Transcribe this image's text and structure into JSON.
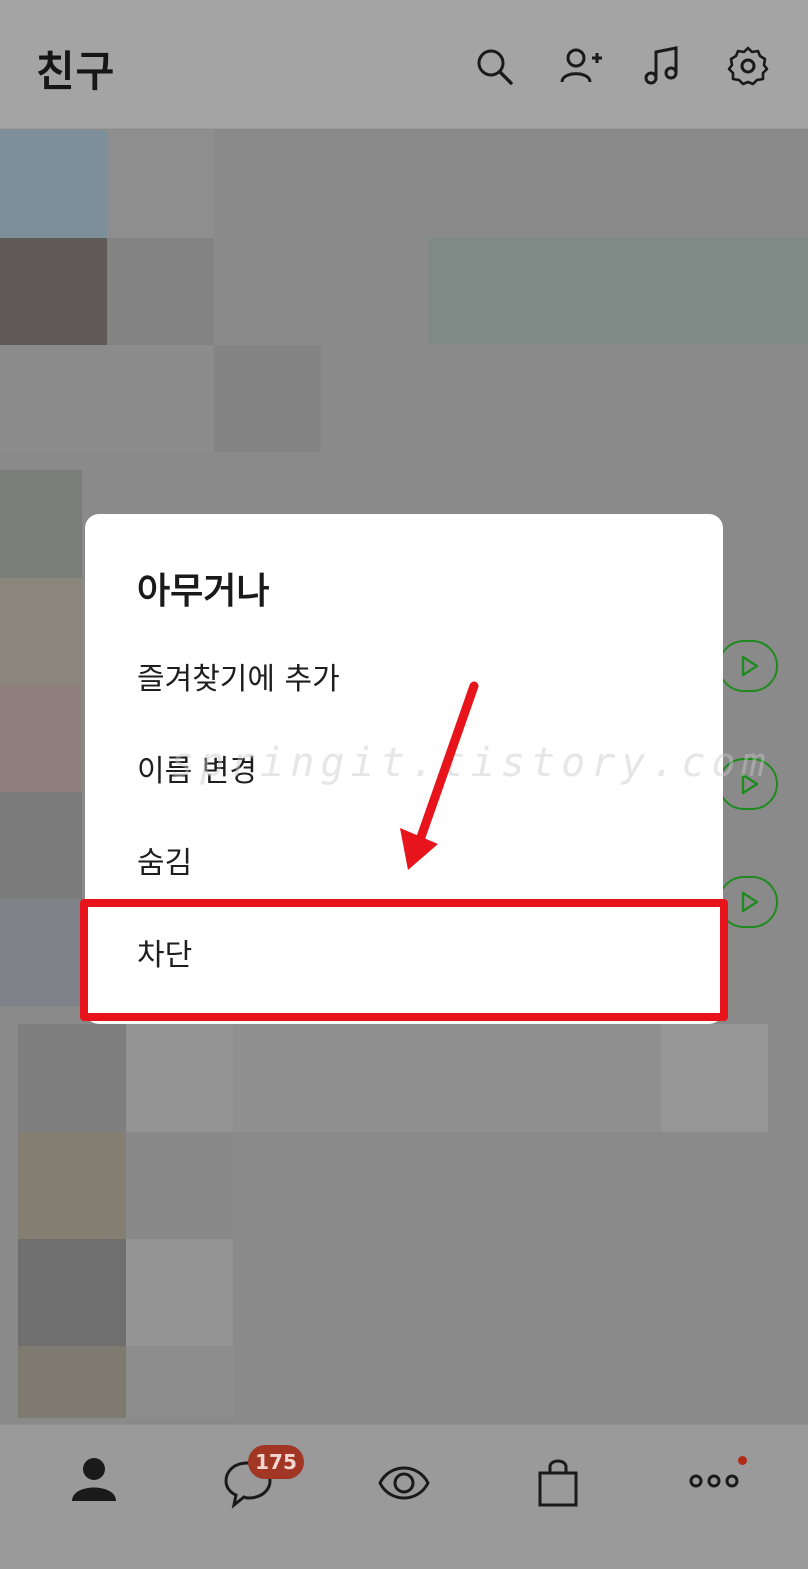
{
  "header": {
    "title": "친구",
    "icons": [
      "search-icon",
      "add-friend-icon",
      "music-icon",
      "settings-icon"
    ]
  },
  "dialog": {
    "title": "아무거나",
    "options": [
      {
        "label": "즐겨찾기에 추가"
      },
      {
        "label": "이름 변경"
      },
      {
        "label": "숨김"
      },
      {
        "label": "차단"
      }
    ],
    "highlighted_option": "차단"
  },
  "watermark": "springit.tistory.com",
  "bottom_nav": {
    "items": [
      "friends-icon",
      "chat-icon",
      "view-icon",
      "shopping-icon",
      "more-icon"
    ],
    "chat_badge": "175"
  },
  "colors": {
    "highlight": "#e8141c",
    "badge": "#a03623",
    "play_button": "#1f8a1f"
  }
}
